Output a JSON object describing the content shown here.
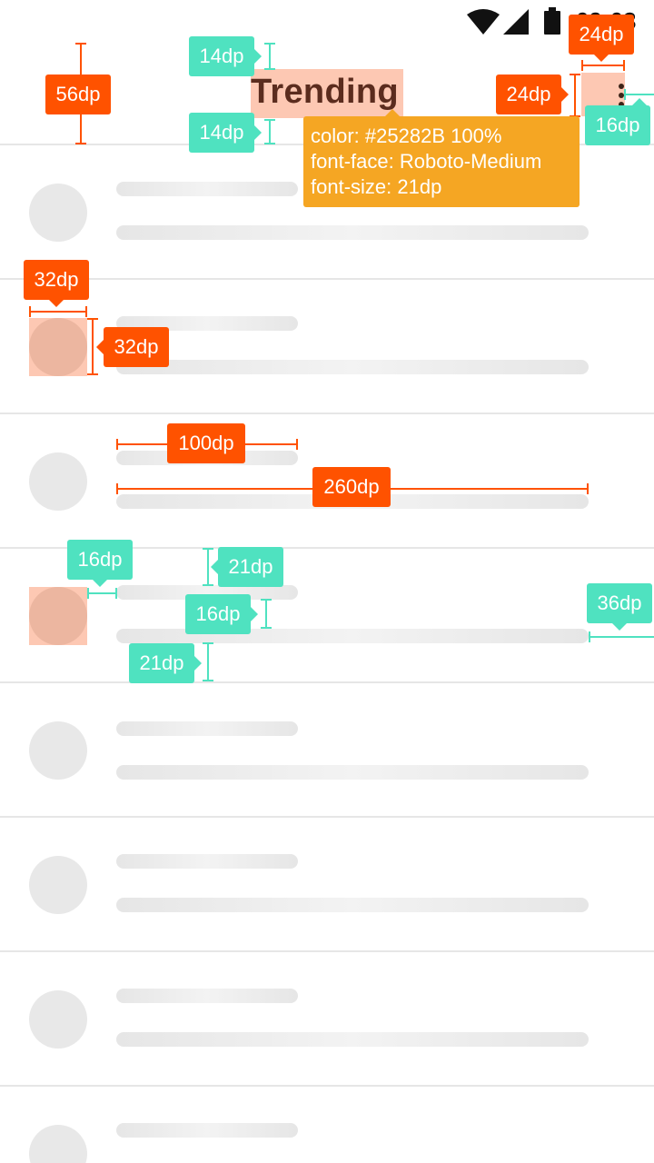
{
  "status_bar": {
    "time": "09:03",
    "icons": [
      "wifi-icon",
      "cellular-signal-icon",
      "battery-icon"
    ]
  },
  "app_bar": {
    "title": "Trending",
    "overflow_icon": "more-vertical-icon"
  },
  "title_spec": {
    "color_line": "color: #25282B 100%",
    "font_face_line": "font-face: Roboto-Medium",
    "font_size_line": "font-size: 21dp"
  },
  "list": {
    "row_count": 8,
    "placeholder": "skeleton"
  },
  "annotations": {
    "app_bar_height": "56dp",
    "title_top_padding": "14dp",
    "title_bottom_padding": "14dp",
    "icon_width": "24dp",
    "icon_height": "24dp",
    "icon_right_margin": "16dp",
    "avatar_width": "32dp",
    "avatar_height": "32dp",
    "short_line_width": "100dp",
    "long_line_width": "260dp",
    "avatar_text_gap": "16dp",
    "row_top_padding": "21dp",
    "line_gap": "16dp",
    "row_bottom_padding": "21dp",
    "line_right_margin": "36dp"
  },
  "colors": {
    "annotation_orange": "#FF5200",
    "annotation_teal": "#4FE2C0",
    "tooltip": "#F5A623",
    "highlight": "#FDC8B3",
    "skeleton": "#E8E8E8"
  }
}
